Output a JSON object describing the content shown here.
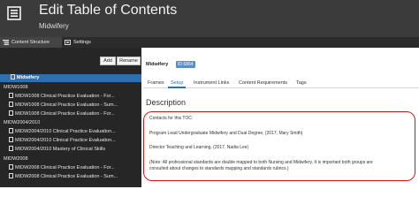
{
  "header": {
    "title": "Edit Table of Contents",
    "subtitle": "Midwifery"
  },
  "topTabs": [
    {
      "label": "Content Structure",
      "active": true
    },
    {
      "label": "Settings",
      "active": false
    }
  ],
  "toolbar": {
    "add_label": "Add",
    "rename_label": "Rename"
  },
  "tree": [
    {
      "label": "Midwifery",
      "type": "doc",
      "selected": true
    },
    {
      "label": "MIDW1008",
      "type": "folder"
    },
    {
      "label": "MIDW1008 Clinical Practice Evaluation - For...",
      "type": "item"
    },
    {
      "label": "MIDW1008 Clinical Practice Evaluation - Sum...",
      "type": "item"
    },
    {
      "label": "MIDW1008 Clinical Practice Evaluation - For...",
      "type": "item"
    },
    {
      "label": "MIDW2004/2010",
      "type": "folder"
    },
    {
      "label": "MIDW2004/2010 Clinical Practice Evaluation...",
      "type": "item"
    },
    {
      "label": "MIDW2004/2010 Clinical Practice Evaluation...",
      "type": "item"
    },
    {
      "label": "MIDW2004/2010 Mastery of Clinical Skills",
      "type": "item"
    },
    {
      "label": "MIDW2008",
      "type": "folder"
    },
    {
      "label": "MIDW2008 Clinical Practice Evaluation - For...",
      "type": "item"
    },
    {
      "label": "MIDW2008 Clinical Practice Evaluation - Sum...",
      "type": "item"
    }
  ],
  "content": {
    "breadcrumb": "Midwifery",
    "id_badge": "ID 6864",
    "tabs": [
      {
        "label": "Frames",
        "active": false
      },
      {
        "label": "Setup",
        "active": true
      },
      {
        "label": "Instrument Links",
        "active": false
      },
      {
        "label": "Content Requirements",
        "active": false
      },
      {
        "label": "Tags",
        "active": false
      }
    ],
    "section_title": "Description",
    "description_lines": [
      "Contacts for this TOC:",
      "",
      "Program Lead Undergraduate Midwifery and Dual Degree, (2017, Mary Smith)",
      "",
      "Director Teaching and Learning, (2017, Nadia Lee)",
      "",
      "(Note: All professional standards are double mapped to both Nursing and Midwifery. It is important both groups are",
      "consulted about changes to standards mapping and standards rubrics.)"
    ]
  },
  "colors": {
    "header_bg": "#3b3b3b",
    "panel_bg": "#262626",
    "selected_bg": "#2f6fb0",
    "badge_bg": "#5e8ec6",
    "highlight_border": "#d01818"
  }
}
